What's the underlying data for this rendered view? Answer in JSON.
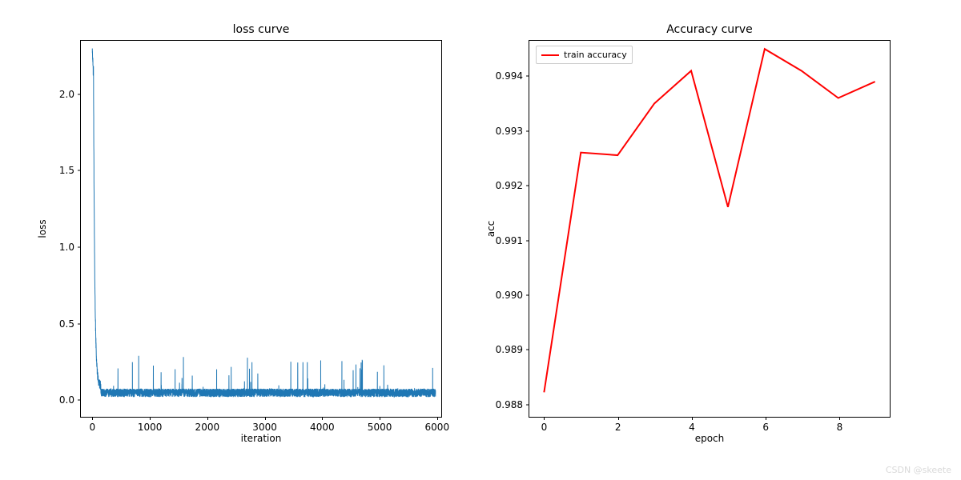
{
  "chart_data": [
    {
      "type": "line",
      "title": "loss curve",
      "xlabel": "iteration",
      "ylabel": "loss",
      "xlim": [
        -200,
        6100
      ],
      "ylim": [
        -0.12,
        2.35
      ],
      "xticks": [
        0,
        1000,
        2000,
        3000,
        4000,
        5000,
        6000
      ],
      "yticks": [
        0.0,
        0.5,
        1.0,
        1.5,
        2.0
      ],
      "color": "#1f77b4",
      "linewidth": 1,
      "series_note": "Noisy training loss over ~6000 iterations; sharp drop from ~2.3 to ~0.1 in first ~100 iters, then jittery plateau 0.00–0.20 with occasional spikes up to ~0.3.",
      "x": "generated",
      "n_points": 6000
    },
    {
      "type": "line",
      "title": "Accuracy curve",
      "xlabel": "epoch",
      "ylabel": "acc",
      "xlim": [
        -0.4,
        9.4
      ],
      "ylim": [
        0.98775,
        0.99465
      ],
      "xticks": [
        0,
        2,
        4,
        6,
        8
      ],
      "yticks": [
        0.988,
        0.989,
        0.99,
        0.991,
        0.992,
        0.993,
        0.994
      ],
      "color": "red",
      "linewidth": 2,
      "legend": [
        "train accuracy"
      ],
      "legend_loc": "upper left",
      "x": [
        0,
        1,
        2,
        3,
        4,
        5,
        6,
        7,
        8,
        9
      ],
      "values": [
        0.9882,
        0.9926,
        0.99255,
        0.9935,
        0.9941,
        0.9916,
        0.9945,
        0.9941,
        0.9936,
        0.9939
      ]
    }
  ],
  "watermark": "CSDN @skeete",
  "loss_title": "loss curve",
  "loss_xlabel": "iteration",
  "loss_ylabel": "loss",
  "acc_title": "Accuracy curve",
  "acc_xlabel": "epoch",
  "acc_ylabel": "acc",
  "acc_legend": "train accuracy"
}
